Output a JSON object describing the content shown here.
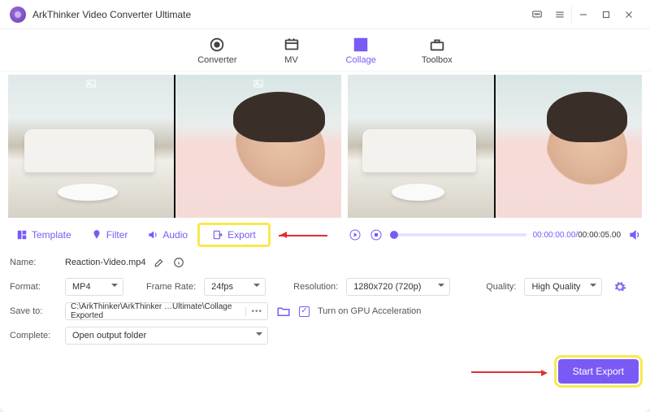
{
  "app": {
    "title": "ArkThinker Video Converter Ultimate"
  },
  "mainTabs": {
    "converter": "Converter",
    "mv": "MV",
    "collage": "Collage",
    "toolbox": "Toolbox",
    "active": "collage"
  },
  "subTabs": {
    "template": "Template",
    "filter": "Filter",
    "audio": "Audio",
    "export": "Export"
  },
  "player": {
    "current": "00:00:00.00",
    "duration": "00:00:05.00"
  },
  "form": {
    "nameLabel": "Name:",
    "nameValue": "Reaction-Video.mp4",
    "formatLabel": "Format:",
    "formatValue": "MP4",
    "frameRateLabel": "Frame Rate:",
    "frameRateValue": "24fps",
    "resolutionLabel": "Resolution:",
    "resolutionValue": "1280x720 (720p)",
    "qualityLabel": "Quality:",
    "qualityValue": "High Quality",
    "saveToLabel": "Save to:",
    "saveToValue": "C:\\ArkThinker\\ArkThinker …Ultimate\\Collage Exported",
    "gpuLabel": "Turn on GPU Acceleration",
    "completeLabel": "Complete:",
    "completeValue": "Open output folder"
  },
  "footer": {
    "startExport": "Start Export"
  },
  "icons": {
    "slotImage": "image-icon"
  }
}
